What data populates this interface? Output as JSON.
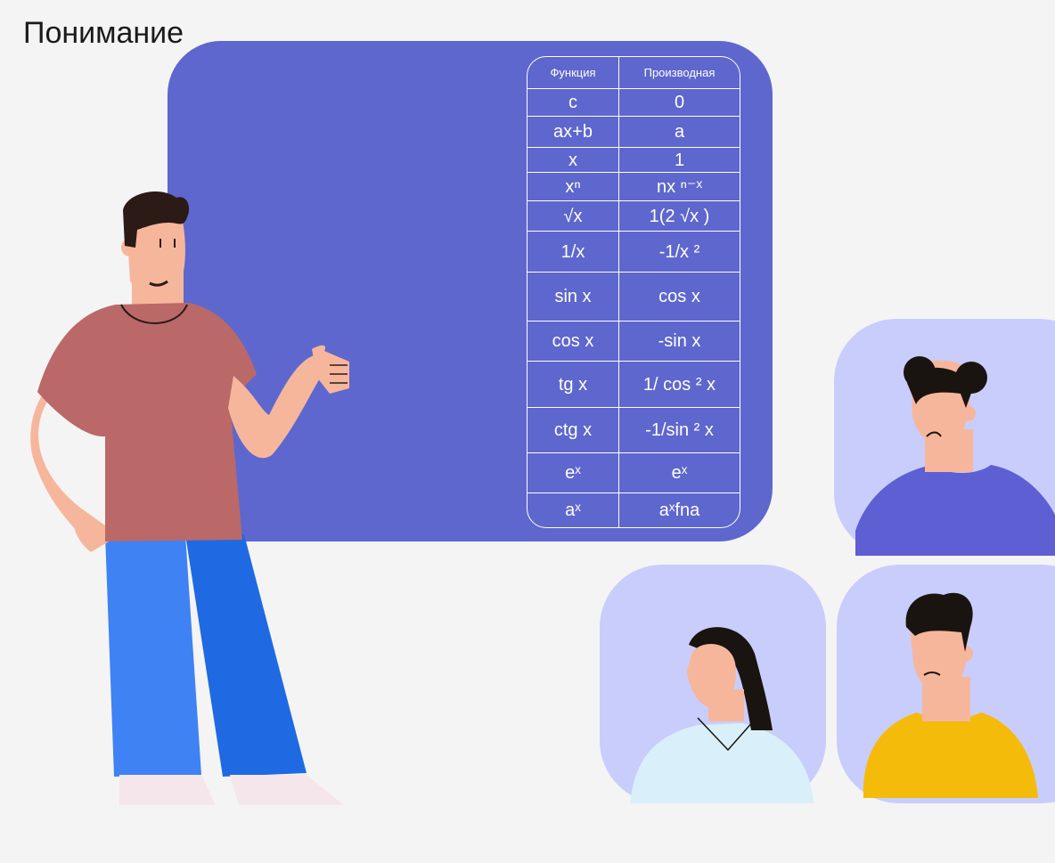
{
  "title": "Понимание",
  "table": {
    "headers": [
      "Функция",
      "Производная"
    ],
    "rows": [
      [
        "c",
        "0"
      ],
      [
        "ax+b",
        "a"
      ],
      [
        "x",
        "1"
      ],
      [
        "xⁿ",
        "nx ⁿ⁻ˣ"
      ],
      [
        "√x",
        "1(2 √x )"
      ],
      [
        "1/x",
        "-1/x ²"
      ],
      [
        "sin x",
        "cos x"
      ],
      [
        "cos x",
        "-sin x"
      ],
      [
        "tg x",
        "1/ cos ² x"
      ],
      [
        "ctg x",
        "-1/sin ² x"
      ],
      [
        "eˣ",
        "eˣ"
      ],
      [
        "aˣ",
        "aˣfna"
      ]
    ]
  },
  "colors": {
    "background": "#f4f4f4",
    "board": "#5e67cd",
    "avatar_bg": "#c9cdfb",
    "skin": "#f6b69c",
    "hair": "#2b1a16",
    "teacher_shirt": "#bb6868",
    "teacher_pants_light": "#3f82f3",
    "teacher_pants_dark": "#1f6ae3",
    "student1_shirt": "#5e5fd2",
    "student2_shirt": "#d9f0fa",
    "student3_shirt": "#f4bb0b"
  }
}
